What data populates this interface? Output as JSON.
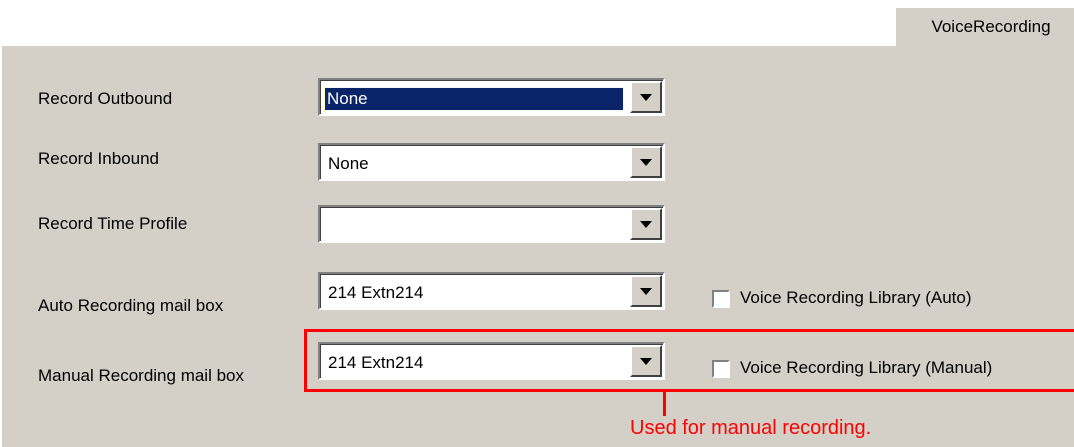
{
  "tab": {
    "label": "VoiceRecording"
  },
  "fields": {
    "record_outbound": {
      "label": "Record Outbound",
      "value": "None"
    },
    "record_inbound": {
      "label": "Record Inbound",
      "value": "None"
    },
    "record_time_profile": {
      "label": "Record Time Profile",
      "value": ""
    },
    "auto_recording_mailbox": {
      "label": "Auto Recording mail box",
      "value": "214  Extn214"
    },
    "manual_recording_mailbox": {
      "label": "Manual Recording mail box",
      "value": "214  Extn214"
    }
  },
  "checkboxes": {
    "library_auto": {
      "label": "Voice Recording Library (Auto)",
      "checked": false
    },
    "library_manual": {
      "label": "Voice Recording Library (Manual)",
      "checked": false
    }
  },
  "annotation": {
    "text": "Used for manual recording.",
    "color": "#ff0000"
  },
  "colors": {
    "panel": "#d4d0c8",
    "selection": "#0a246a"
  }
}
